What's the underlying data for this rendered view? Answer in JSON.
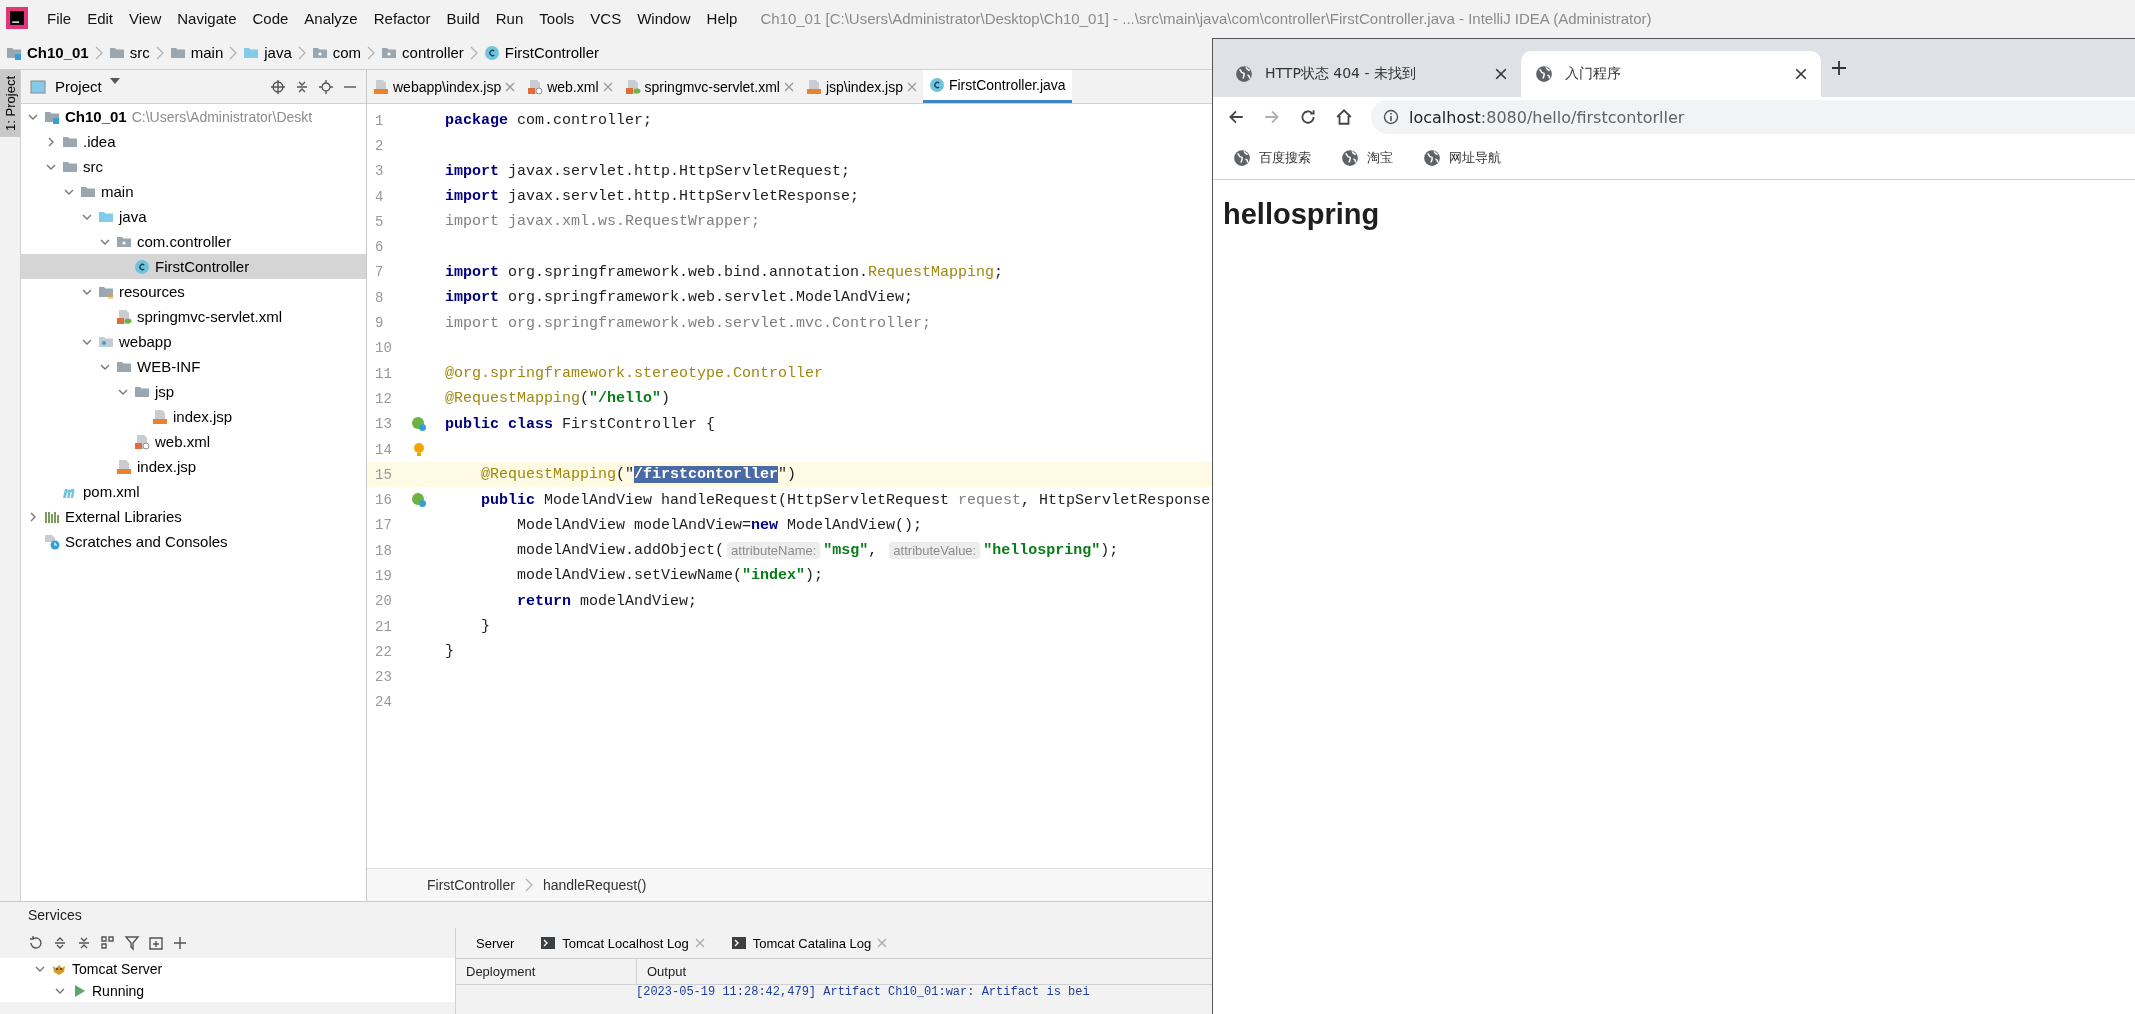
{
  "window": {
    "title": "Ch10_01 [C:\\Users\\Administrator\\Desktop\\Ch10_01] - ...\\src\\main\\java\\com\\controller\\FirstController.java - IntelliJ IDEA (Administrator)"
  },
  "menu": [
    "File",
    "Edit",
    "View",
    "Navigate",
    "Code",
    "Analyze",
    "Refactor",
    "Build",
    "Run",
    "Tools",
    "VCS",
    "Window",
    "Help"
  ],
  "breadcrumb": [
    {
      "label": "Ch10_01",
      "kind": "module"
    },
    {
      "label": "src",
      "kind": "folder"
    },
    {
      "label": "main",
      "kind": "folder"
    },
    {
      "label": "java",
      "kind": "source"
    },
    {
      "label": "com",
      "kind": "package"
    },
    {
      "label": "controller",
      "kind": "package"
    },
    {
      "label": "FirstController",
      "kind": "class"
    }
  ],
  "side_tab": "1: Project",
  "project": {
    "title": "Project",
    "tree": [
      {
        "label": "Ch10_01",
        "kind": "module",
        "path": "C:\\Users\\Administrator\\Deskt",
        "expanded": true,
        "selected": false,
        "children": [
          {
            "label": ".idea",
            "kind": "folder",
            "expanded": false,
            "selected": false
          },
          {
            "label": "src",
            "kind": "folder",
            "expanded": true,
            "selected": false,
            "children": [
              {
                "label": "main",
                "kind": "folder",
                "expanded": true,
                "selected": false,
                "children": [
                  {
                    "label": "java",
                    "kind": "source",
                    "expanded": true,
                    "selected": false,
                    "children": [
                      {
                        "label": "com.controller",
                        "kind": "package",
                        "expanded": true,
                        "selected": false,
                        "children": [
                          {
                            "label": "FirstController",
                            "kind": "class",
                            "selected": true
                          }
                        ]
                      }
                    ]
                  },
                  {
                    "label": "resources",
                    "kind": "resources",
                    "expanded": true,
                    "selected": false,
                    "children": [
                      {
                        "label": "springmvc-servlet.xml",
                        "kind": "spring-xml",
                        "selected": false
                      }
                    ]
                  },
                  {
                    "label": "webapp",
                    "kind": "web",
                    "expanded": true,
                    "selected": false,
                    "children": [
                      {
                        "label": "WEB-INF",
                        "kind": "folder",
                        "expanded": true,
                        "selected": false,
                        "children": [
                          {
                            "label": "jsp",
                            "kind": "folder",
                            "expanded": true,
                            "selected": false,
                            "children": [
                              {
                                "label": "index.jsp",
                                "kind": "jsp",
                                "selected": false
                              }
                            ]
                          },
                          {
                            "label": "web.xml",
                            "kind": "web-xml",
                            "selected": false
                          }
                        ]
                      },
                      {
                        "label": "index.jsp",
                        "kind": "jsp",
                        "selected": false
                      }
                    ]
                  }
                ]
              }
            ]
          },
          {
            "label": "pom.xml",
            "kind": "maven",
            "selected": false
          }
        ]
      },
      {
        "label": "External Libraries",
        "kind": "libraries",
        "expanded": false,
        "selected": false
      },
      {
        "label": "Scratches and Consoles",
        "kind": "scratches",
        "selected": false
      }
    ]
  },
  "editor": {
    "tabs": [
      {
        "label": "webapp\\index.jsp",
        "kind": "jsp",
        "selected": false
      },
      {
        "label": "web.xml",
        "kind": "web-xml",
        "selected": false
      },
      {
        "label": "springmvc-servlet.xml",
        "kind": "spring-xml",
        "selected": false
      },
      {
        "label": "jsp\\index.jsp",
        "kind": "jsp",
        "selected": false
      },
      {
        "label": "FirstController.java",
        "kind": "class",
        "selected": true
      }
    ],
    "lines": [
      {
        "number": "1",
        "current": false,
        "segments": [
          {
            "kind": "kw",
            "text": "package"
          },
          {
            "kind": "plain",
            "text": " com.controller;"
          }
        ]
      },
      {
        "number": "2",
        "current": false
      },
      {
        "number": "3",
        "current": false,
        "segments": [
          {
            "kind": "kw",
            "text": "import"
          },
          {
            "kind": "plain",
            "text": " javax.servlet.http.HttpServletRequest;"
          }
        ]
      },
      {
        "number": "4",
        "current": false,
        "segments": [
          {
            "kind": "kw",
            "text": "import"
          },
          {
            "kind": "plain",
            "text": " javax.servlet.http.HttpServletResponse;"
          }
        ]
      },
      {
        "number": "5",
        "current": false,
        "segments": [
          {
            "kind": "unused",
            "text": "import javax.xml.ws.RequestWrapper;"
          }
        ]
      },
      {
        "number": "6",
        "current": false
      },
      {
        "number": "7",
        "current": false,
        "segments": [
          {
            "kind": "kw",
            "text": "import"
          },
          {
            "kind": "plain",
            "text": " org.springframework.web.bind.annotation."
          },
          {
            "kind": "ann",
            "text": "RequestMapping"
          },
          {
            "kind": "plain",
            "text": ";"
          }
        ]
      },
      {
        "number": "8",
        "current": false,
        "segments": [
          {
            "kind": "kw",
            "text": "import"
          },
          {
            "kind": "plain",
            "text": " org.springframework.web.servlet.ModelAndView;"
          }
        ]
      },
      {
        "number": "9",
        "current": false,
        "segments": [
          {
            "kind": "unused",
            "text": "import org.springframework.web.servlet.mvc.Controller;"
          }
        ]
      },
      {
        "number": "10",
        "current": false
      },
      {
        "number": "11",
        "current": false,
        "segments": [
          {
            "kind": "ann",
            "text": "@org.springframework.stereotype."
          },
          {
            "kind": "ann",
            "text": "Controller"
          }
        ]
      },
      {
        "number": "12",
        "current": false,
        "segments": [
          {
            "kind": "ann",
            "text": "@RequestMapping"
          },
          {
            "kind": "plain",
            "text": "("
          },
          {
            "kind": "str",
            "text": "\"/hello\""
          },
          {
            "kind": "plain",
            "text": ")"
          }
        ]
      },
      {
        "number": "13",
        "current": false,
        "kind": "bean",
        "segments": [
          {
            "kind": "kw",
            "text": "public class"
          },
          {
            "kind": "plain",
            "text": " FirstController {"
          }
        ]
      },
      {
        "number": "14",
        "current": false,
        "kind": "bulb"
      },
      {
        "number": "15",
        "current": true,
        "segments": [
          {
            "kind": "ann",
            "text": "    @RequestMapping"
          },
          {
            "kind": "plain",
            "text": "(\""
          },
          {
            "kind": "sel",
            "text": "/firstcontorller"
          },
          {
            "kind": "plain",
            "text": "\")"
          }
        ]
      },
      {
        "number": "16",
        "current": false,
        "kind": "bean",
        "segments": [
          {
            "kind": "kw",
            "text": "    public"
          },
          {
            "kind": "plain",
            "text": " ModelAndView handleRequest(HttpServletRequest "
          },
          {
            "kind": "unused",
            "text": "request"
          },
          {
            "kind": "plain",
            "text": ", HttpServletResponse"
          }
        ]
      },
      {
        "number": "17",
        "current": false,
        "segments": [
          {
            "kind": "plain",
            "text": "        ModelAndView modelAndView="
          },
          {
            "kind": "kw",
            "text": "new"
          },
          {
            "kind": "plain",
            "text": " ModelAndView();"
          }
        ]
      },
      {
        "number": "18",
        "current": false,
        "segments": [
          {
            "kind": "plain",
            "text": "        modelAndView.addObject("
          },
          {
            "kind": "hint",
            "text": "attributeName:"
          },
          {
            "kind": "str",
            "text": "\"msg\""
          },
          {
            "kind": "plain",
            "text": ", "
          },
          {
            "kind": "hint",
            "text": "attributeValue:"
          },
          {
            "kind": "str",
            "text": "\"hellospring\""
          },
          {
            "kind": "plain",
            "text": ");"
          }
        ]
      },
      {
        "number": "19",
        "current": false,
        "segments": [
          {
            "kind": "plain",
            "text": "        modelAndView.setViewName("
          },
          {
            "kind": "str",
            "text": "\"index\""
          },
          {
            "kind": "plain",
            "text": ");"
          }
        ]
      },
      {
        "number": "20",
        "current": false,
        "segments": [
          {
            "kind": "kw",
            "text": "        return"
          },
          {
            "kind": "plain",
            "text": " modelAndView;"
          }
        ]
      },
      {
        "number": "21",
        "current": false,
        "segments": [
          {
            "kind": "plain",
            "text": "    }"
          }
        ]
      },
      {
        "number": "22",
        "current": false,
        "segments": [
          {
            "kind": "plain",
            "text": "}"
          }
        ]
      },
      {
        "number": "23",
        "current": false
      },
      {
        "number": "24",
        "current": false
      }
    ],
    "breadcrumb": [
      "FirstController",
      "handleRequest()"
    ]
  },
  "services": {
    "title": "Services",
    "tree": [
      {
        "label": "Tomcat Server",
        "kind": "tomcat",
        "expanded": true
      },
      {
        "label": "Running",
        "kind": "run",
        "expanded": true
      }
    ],
    "tabs": [
      {
        "label": "Server"
      },
      {
        "label": "Tomcat Localhost Log",
        "kind": "log"
      },
      {
        "label": "Tomcat Catalina Log",
        "kind": "log"
      }
    ],
    "columns": [
      "Deployment",
      "Output"
    ],
    "log": "[2023-05-19 11:28:42,479] Artifact Ch10_01:war: Artifact is bei"
  },
  "browser": {
    "tabs": [
      {
        "title": "HTTP状态 404 - 未找到",
        "selected": false
      },
      {
        "title": "入门程序",
        "selected": true
      }
    ],
    "nav": [
      {
        "kind": "back",
        "disabled": false
      },
      {
        "kind": "forward",
        "disabled": true
      },
      {
        "kind": "reload",
        "disabled": false
      },
      {
        "kind": "home",
        "disabled": false
      }
    ],
    "address": {
      "host": "localhost",
      "path": ":8080/hello/firstcontorller"
    },
    "bookmarks": [
      "百度搜索",
      "淘宝",
      "网址导航"
    ],
    "page": {
      "heading": "hellospring"
    }
  }
}
